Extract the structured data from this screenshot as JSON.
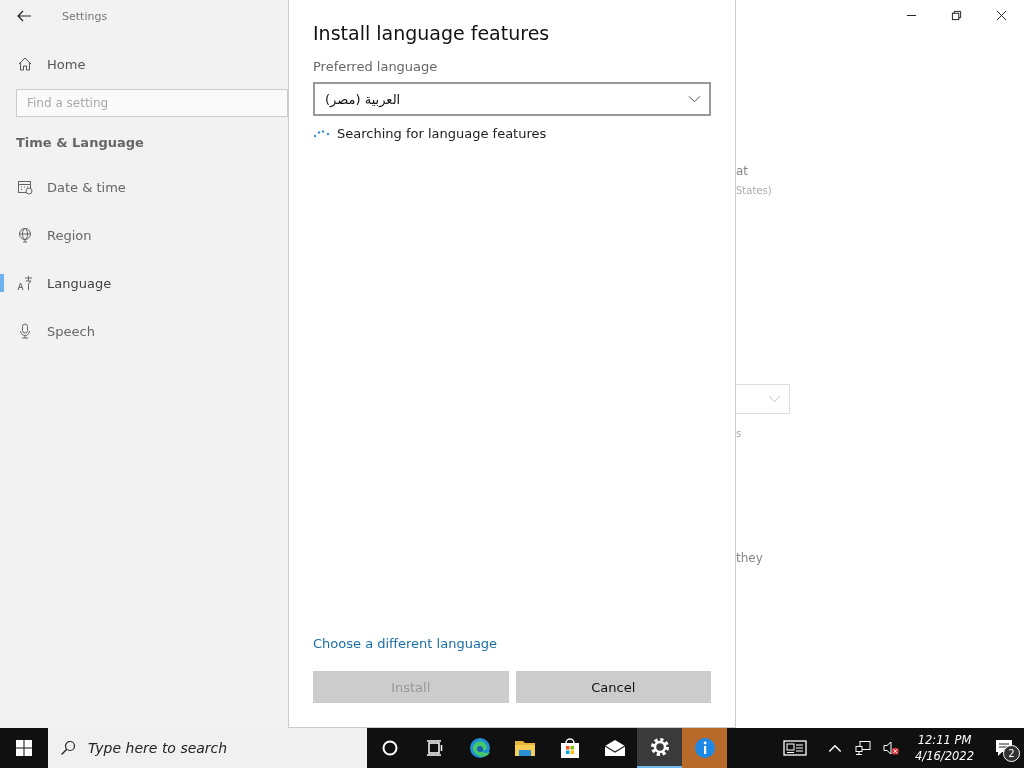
{
  "window": {
    "title": "Settings"
  },
  "sidebar": {
    "home": "Home",
    "search": {
      "placeholder": "Find a setting"
    },
    "section": "Time & Language",
    "items": [
      {
        "label": "Date & time",
        "selected": false
      },
      {
        "label": "Region",
        "selected": false
      },
      {
        "label": "Language",
        "selected": true
      },
      {
        "label": "Speech",
        "selected": false
      }
    ]
  },
  "background_fragments": {
    "line_1": "at",
    "line_2": "States)",
    "line_3": "s",
    "line_4": "they"
  },
  "dialog": {
    "title": "Install language features",
    "field_label": "Preferred language",
    "field_value": "العربية (مصر)",
    "status": "Searching for language features",
    "link": "Choose a different language",
    "buttons": [
      {
        "label": "Install",
        "disabled": true
      },
      {
        "label": "Cancel",
        "disabled": false
      }
    ]
  },
  "taskbar": {
    "search": {
      "placeholder": "Type here to search"
    },
    "apps": [
      {
        "active": false
      },
      {
        "active": false
      },
      {
        "active": false
      },
      {
        "active": false
      },
      {
        "active": false
      },
      {
        "active": false
      },
      {
        "active": true
      },
      {
        "active": false,
        "highlighted": true
      }
    ],
    "time": "12:11 PM",
    "date": "4/16/2022",
    "notifications": "2"
  }
}
